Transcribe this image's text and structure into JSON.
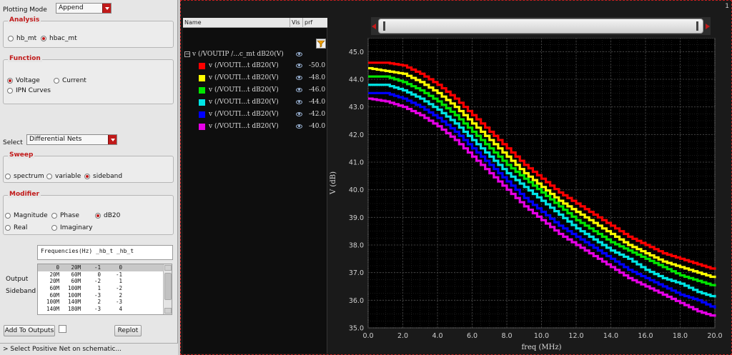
{
  "left_panel": {
    "plotting_mode": {
      "label": "Plotting Mode",
      "value": "Append"
    },
    "analysis": {
      "title": "Analysis",
      "options": [
        "hb_mt",
        "hbac_mt"
      ],
      "selected": "hbac_mt"
    },
    "function": {
      "title": "Function",
      "options": [
        "Voltage",
        "Current",
        "IPN Curves"
      ],
      "selected": "Voltage"
    },
    "select": {
      "label": "Select",
      "value": "Differential Nets"
    },
    "sweep": {
      "title": "Sweep",
      "options": [
        "spectrum",
        "variable",
        "sideband"
      ],
      "selected": "sideband"
    },
    "modifier": {
      "title": "Modifier",
      "options": [
        "Magnitude",
        "Phase",
        "dB20",
        "Real",
        "Imaginary"
      ],
      "selected": "dB20"
    },
    "frequencies_header": "Frequencies(Hz) _hb_t _hb_t",
    "output_label": "Output",
    "sideband_label": "Sideband",
    "sideband_rows": [
      [
        "0",
        "20M",
        "-1",
        "0"
      ],
      [
        "20M",
        "60M",
        "0",
        "-1"
      ],
      [
        "20M",
        "60M",
        "-2",
        "1"
      ],
      [
        "60M",
        "100M",
        "1",
        "-2"
      ],
      [
        "60M",
        "100M",
        "-3",
        "2"
      ],
      [
        "100M",
        "140M",
        "2",
        "-3"
      ],
      [
        "140M",
        "180M",
        "-3",
        "4"
      ]
    ],
    "add_to_outputs_label": "Add To Outputs",
    "replot_label": "Replot",
    "status": "> Select Positive Net on schematic..."
  },
  "legend": {
    "headers": {
      "name": "Name",
      "vis": "Vis",
      "prf": "prf"
    },
    "group_label": "v (/VOUTIP /...c_mt dB20(V)",
    "traces": [
      {
        "label": "v (/VOUTI...t dB20(V)",
        "prf": "-50.0",
        "color": "#ff0000"
      },
      {
        "label": "v (/VOUTI...t dB20(V)",
        "prf": "-48.0",
        "color": "#ffff00"
      },
      {
        "label": "v (/VOUTI...t dB20(V)",
        "prf": "-46.0",
        "color": "#00e600"
      },
      {
        "label": "v (/VOUTI...t dB20(V)",
        "prf": "-44.0",
        "color": "#00e5e5"
      },
      {
        "label": "v (/VOUTI...t dB20(V)",
        "prf": "-42.0",
        "color": "#0000ff"
      },
      {
        "label": "v (/VOUTI...t dB20(V)",
        "prf": "-40.0",
        "color": "#e600e6"
      }
    ]
  },
  "window_badge": "1",
  "chart_data": {
    "type": "line",
    "xlabel": "freq (MHz)",
    "ylabel": "V (dB)",
    "xlim": [
      0,
      20
    ],
    "ylim": [
      35,
      45.5
    ],
    "x_ticks": [
      "0.0",
      "2.0",
      "4.0",
      "6.0",
      "8.0",
      "10.0",
      "12.0",
      "14.0",
      "16.0",
      "18.0",
      "20.0"
    ],
    "y_ticks": [
      "35.0",
      "36.0",
      "37.0",
      "38.0",
      "39.0",
      "40.0",
      "41.0",
      "42.0",
      "43.0",
      "44.0",
      "45.0"
    ],
    "grid": true,
    "x": [
      0,
      1,
      2,
      3,
      4,
      5,
      6,
      7,
      8,
      9,
      10,
      11,
      12,
      13,
      14,
      15,
      16,
      17,
      18,
      19,
      20
    ],
    "series": [
      {
        "name": "-50.0",
        "color": "#ff0000",
        "values": [
          44.6,
          44.6,
          44.5,
          44.2,
          43.8,
          43.3,
          42.7,
          42.1,
          41.5,
          40.9,
          40.4,
          39.9,
          39.5,
          39.1,
          38.7,
          38.3,
          38.0,
          37.7,
          37.5,
          37.3,
          37.1
        ]
      },
      {
        "name": "-48.0",
        "color": "#ffff00",
        "values": [
          44.4,
          44.3,
          44.2,
          43.9,
          43.5,
          43.0,
          42.4,
          41.8,
          41.2,
          40.6,
          40.1,
          39.6,
          39.2,
          38.8,
          38.4,
          38.0,
          37.7,
          37.4,
          37.2,
          37.0,
          36.8
        ]
      },
      {
        "name": "-46.0",
        "color": "#00e600",
        "values": [
          44.1,
          44.1,
          43.9,
          43.6,
          43.2,
          42.7,
          42.1,
          41.5,
          40.9,
          40.4,
          39.9,
          39.4,
          38.9,
          38.5,
          38.1,
          37.8,
          37.5,
          37.2,
          36.9,
          36.7,
          36.5
        ]
      },
      {
        "name": "-44.0",
        "color": "#00e5e5",
        "values": [
          43.8,
          43.8,
          43.6,
          43.3,
          42.9,
          42.4,
          41.8,
          41.2,
          40.6,
          40.1,
          39.6,
          39.1,
          38.6,
          38.2,
          37.8,
          37.5,
          37.1,
          36.8,
          36.6,
          36.3,
          36.1
        ]
      },
      {
        "name": "-42.0",
        "color": "#0000ff",
        "values": [
          43.5,
          43.5,
          43.3,
          43.0,
          42.6,
          42.1,
          41.5,
          40.9,
          40.3,
          39.7,
          39.2,
          38.7,
          38.3,
          37.9,
          37.5,
          37.1,
          36.8,
          36.5,
          36.2,
          36.0,
          35.7
        ]
      },
      {
        "name": "-40.0",
        "color": "#e600e6",
        "values": [
          43.3,
          43.2,
          43.0,
          42.7,
          42.3,
          41.8,
          41.2,
          40.6,
          40.0,
          39.4,
          38.9,
          38.4,
          38.0,
          37.6,
          37.2,
          36.8,
          36.5,
          36.2,
          35.9,
          35.6,
          35.4
        ]
      }
    ]
  }
}
